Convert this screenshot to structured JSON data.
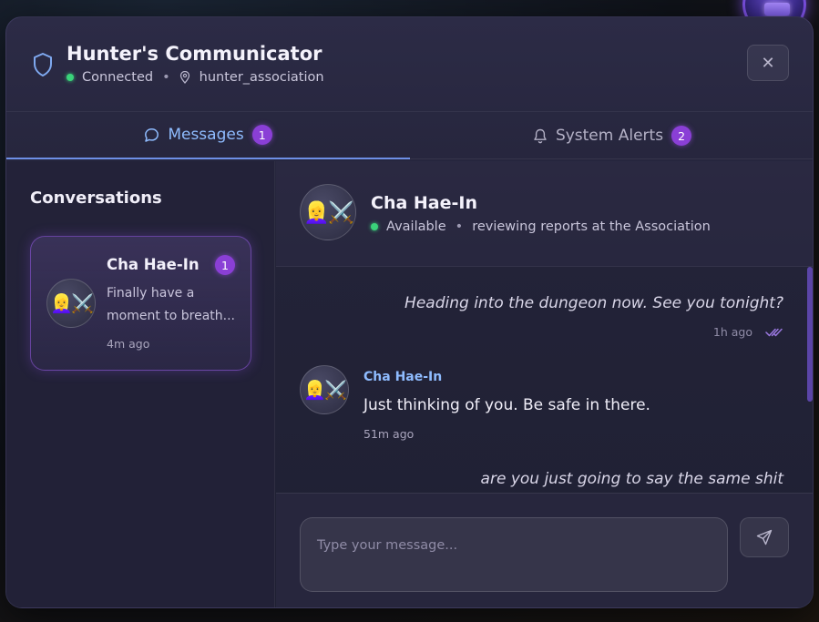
{
  "header": {
    "title": "Hunter's Communicator",
    "connection_status": "Connected",
    "separator": "•",
    "location": "hunter_association",
    "close_label": "✕"
  },
  "tabs": [
    {
      "label": "Messages",
      "badge": "1",
      "active": true,
      "icon": "chat-bubble-icon"
    },
    {
      "label": "System Alerts",
      "badge": "2",
      "active": false,
      "icon": "bell-icon"
    }
  ],
  "sidebar": {
    "title": "Conversations",
    "conversations": [
      {
        "name": "Cha Hae-In",
        "avatar": "👱‍♀️⚔️",
        "unread": "1",
        "preview": "Finally have a moment to breath...",
        "time": "4m ago"
      }
    ]
  },
  "chat": {
    "contact_name": "Cha Hae-In",
    "avatar": "👱‍♀️⚔️",
    "availability": "Available",
    "separator": "•",
    "activity": "reviewing reports at the Association",
    "messages": [
      {
        "direction": "out",
        "text": "Heading into the dungeon now. See you tonight?",
        "time": "1h ago",
        "read": true
      },
      {
        "direction": "in",
        "sender": "Cha Hae-In",
        "text": "Just thinking of you. Be safe in there.",
        "time": "51m ago"
      },
      {
        "direction": "out",
        "text": "are you just going to say the same shit"
      }
    ],
    "composer_placeholder": "Type your message..."
  },
  "colors": {
    "accent": "#8fbcff",
    "badge": "#8a3fd6",
    "online": "#3ad37a"
  }
}
